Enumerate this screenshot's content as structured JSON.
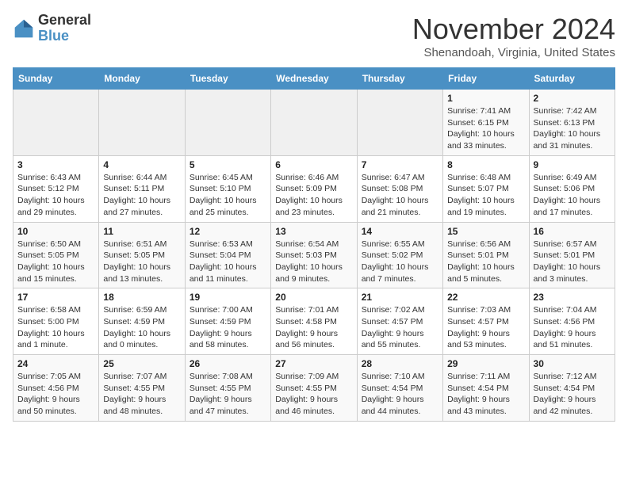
{
  "header": {
    "logo_general": "General",
    "logo_blue": "Blue",
    "month_title": "November 2024",
    "location": "Shenandoah, Virginia, United States"
  },
  "days_of_week": [
    "Sunday",
    "Monday",
    "Tuesday",
    "Wednesday",
    "Thursday",
    "Friday",
    "Saturday"
  ],
  "weeks": [
    [
      {
        "day": "",
        "info": ""
      },
      {
        "day": "",
        "info": ""
      },
      {
        "day": "",
        "info": ""
      },
      {
        "day": "",
        "info": ""
      },
      {
        "day": "",
        "info": ""
      },
      {
        "day": "1",
        "info": "Sunrise: 7:41 AM\nSunset: 6:15 PM\nDaylight: 10 hours\nand 33 minutes."
      },
      {
        "day": "2",
        "info": "Sunrise: 7:42 AM\nSunset: 6:13 PM\nDaylight: 10 hours\nand 31 minutes."
      }
    ],
    [
      {
        "day": "3",
        "info": "Sunrise: 6:43 AM\nSunset: 5:12 PM\nDaylight: 10 hours\nand 29 minutes."
      },
      {
        "day": "4",
        "info": "Sunrise: 6:44 AM\nSunset: 5:11 PM\nDaylight: 10 hours\nand 27 minutes."
      },
      {
        "day": "5",
        "info": "Sunrise: 6:45 AM\nSunset: 5:10 PM\nDaylight: 10 hours\nand 25 minutes."
      },
      {
        "day": "6",
        "info": "Sunrise: 6:46 AM\nSunset: 5:09 PM\nDaylight: 10 hours\nand 23 minutes."
      },
      {
        "day": "7",
        "info": "Sunrise: 6:47 AM\nSunset: 5:08 PM\nDaylight: 10 hours\nand 21 minutes."
      },
      {
        "day": "8",
        "info": "Sunrise: 6:48 AM\nSunset: 5:07 PM\nDaylight: 10 hours\nand 19 minutes."
      },
      {
        "day": "9",
        "info": "Sunrise: 6:49 AM\nSunset: 5:06 PM\nDaylight: 10 hours\nand 17 minutes."
      }
    ],
    [
      {
        "day": "10",
        "info": "Sunrise: 6:50 AM\nSunset: 5:05 PM\nDaylight: 10 hours\nand 15 minutes."
      },
      {
        "day": "11",
        "info": "Sunrise: 6:51 AM\nSunset: 5:05 PM\nDaylight: 10 hours\nand 13 minutes."
      },
      {
        "day": "12",
        "info": "Sunrise: 6:53 AM\nSunset: 5:04 PM\nDaylight: 10 hours\nand 11 minutes."
      },
      {
        "day": "13",
        "info": "Sunrise: 6:54 AM\nSunset: 5:03 PM\nDaylight: 10 hours\nand 9 minutes."
      },
      {
        "day": "14",
        "info": "Sunrise: 6:55 AM\nSunset: 5:02 PM\nDaylight: 10 hours\nand 7 minutes."
      },
      {
        "day": "15",
        "info": "Sunrise: 6:56 AM\nSunset: 5:01 PM\nDaylight: 10 hours\nand 5 minutes."
      },
      {
        "day": "16",
        "info": "Sunrise: 6:57 AM\nSunset: 5:01 PM\nDaylight: 10 hours\nand 3 minutes."
      }
    ],
    [
      {
        "day": "17",
        "info": "Sunrise: 6:58 AM\nSunset: 5:00 PM\nDaylight: 10 hours\nand 1 minute."
      },
      {
        "day": "18",
        "info": "Sunrise: 6:59 AM\nSunset: 4:59 PM\nDaylight: 10 hours\nand 0 minutes."
      },
      {
        "day": "19",
        "info": "Sunrise: 7:00 AM\nSunset: 4:59 PM\nDaylight: 9 hours\nand 58 minutes."
      },
      {
        "day": "20",
        "info": "Sunrise: 7:01 AM\nSunset: 4:58 PM\nDaylight: 9 hours\nand 56 minutes."
      },
      {
        "day": "21",
        "info": "Sunrise: 7:02 AM\nSunset: 4:57 PM\nDaylight: 9 hours\nand 55 minutes."
      },
      {
        "day": "22",
        "info": "Sunrise: 7:03 AM\nSunset: 4:57 PM\nDaylight: 9 hours\nand 53 minutes."
      },
      {
        "day": "23",
        "info": "Sunrise: 7:04 AM\nSunset: 4:56 PM\nDaylight: 9 hours\nand 51 minutes."
      }
    ],
    [
      {
        "day": "24",
        "info": "Sunrise: 7:05 AM\nSunset: 4:56 PM\nDaylight: 9 hours\nand 50 minutes."
      },
      {
        "day": "25",
        "info": "Sunrise: 7:07 AM\nSunset: 4:55 PM\nDaylight: 9 hours\nand 48 minutes."
      },
      {
        "day": "26",
        "info": "Sunrise: 7:08 AM\nSunset: 4:55 PM\nDaylight: 9 hours\nand 47 minutes."
      },
      {
        "day": "27",
        "info": "Sunrise: 7:09 AM\nSunset: 4:55 PM\nDaylight: 9 hours\nand 46 minutes."
      },
      {
        "day": "28",
        "info": "Sunrise: 7:10 AM\nSunset: 4:54 PM\nDaylight: 9 hours\nand 44 minutes."
      },
      {
        "day": "29",
        "info": "Sunrise: 7:11 AM\nSunset: 4:54 PM\nDaylight: 9 hours\nand 43 minutes."
      },
      {
        "day": "30",
        "info": "Sunrise: 7:12 AM\nSunset: 4:54 PM\nDaylight: 9 hours\nand 42 minutes."
      }
    ]
  ]
}
